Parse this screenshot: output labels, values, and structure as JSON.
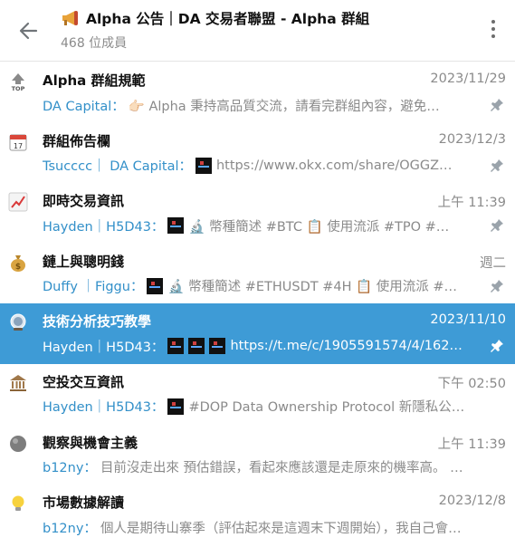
{
  "header": {
    "title": "Alpha 公告｜DA 交易者聯盟 - Alpha 群組",
    "subtitle": "468 位成員",
    "icon": "megaphone-icon"
  },
  "topics": [
    {
      "icon": "top-arrow-icon",
      "title": "Alpha 群組規範",
      "time": "2023/11/29",
      "sender": "DA Capital：",
      "preview": "👉🏻 Alpha 秉持高品質交流，請看完群組內容，避免…",
      "thumbs": 0,
      "pinned": true,
      "active": false
    },
    {
      "icon": "calendar-icon",
      "title": "群組佈告欄",
      "time": "2023/12/3",
      "sender": "Tsucccc｜ DA Capital：",
      "preview": "https://www.okx.com/share/OGGZ…",
      "thumbs": 1,
      "pinned": true,
      "active": false
    },
    {
      "icon": "chart-increasing-icon",
      "title": "即時交易資訊",
      "time": "上午 11:39",
      "sender": "Hayden｜H5D43：",
      "preview": "🔬 幣種簡述 #BTC 📋 使用流派 #TPO #…",
      "thumbs": 1,
      "pinned": true,
      "active": false
    },
    {
      "icon": "money-bag-icon",
      "title": "鏈上與聰明錢",
      "time": "週二",
      "sender": "Duffy ｜Figgu：",
      "preview": "🔬 幣種簡述 #ETHUSDT #4H 📋 使用流派 #…",
      "thumbs": 1,
      "pinned": true,
      "active": false
    },
    {
      "icon": "crystal-ball-icon",
      "title": "技術分析技巧教學",
      "time": "2023/11/10",
      "sender": "Hayden｜H5D43：",
      "preview": "https://t.me/c/1905591574/4/162…",
      "thumbs": 3,
      "pinned": true,
      "active": true
    },
    {
      "icon": "bank-icon",
      "title": "空投交互資訊",
      "time": "下午 02:50",
      "sender": "Hayden｜H5D43：",
      "preview": "#DOP Data Ownership Protocol 新隱私公…",
      "thumbs": 1,
      "pinned": false,
      "active": false
    },
    {
      "icon": "rock-icon",
      "title": "觀察與機會主義",
      "time": "上午 11:39",
      "sender": "b12ny：",
      "preview": "目前沒走出來 預估錯誤，看起來應該還是走原來的機率高。 …",
      "thumbs": 0,
      "pinned": false,
      "active": false
    },
    {
      "icon": "light-bulb-icon",
      "title": "市場數據解讀",
      "time": "2023/12/8",
      "sender": "b12ny：",
      "preview": "個人是期待山寨季（評估起來是這週末下週開始），我自己會…",
      "thumbs": 0,
      "pinned": false,
      "active": false
    }
  ],
  "colors": {
    "accent": "#3e9bd6",
    "sender": "#3390c9",
    "muted": "#8b8b8b"
  }
}
